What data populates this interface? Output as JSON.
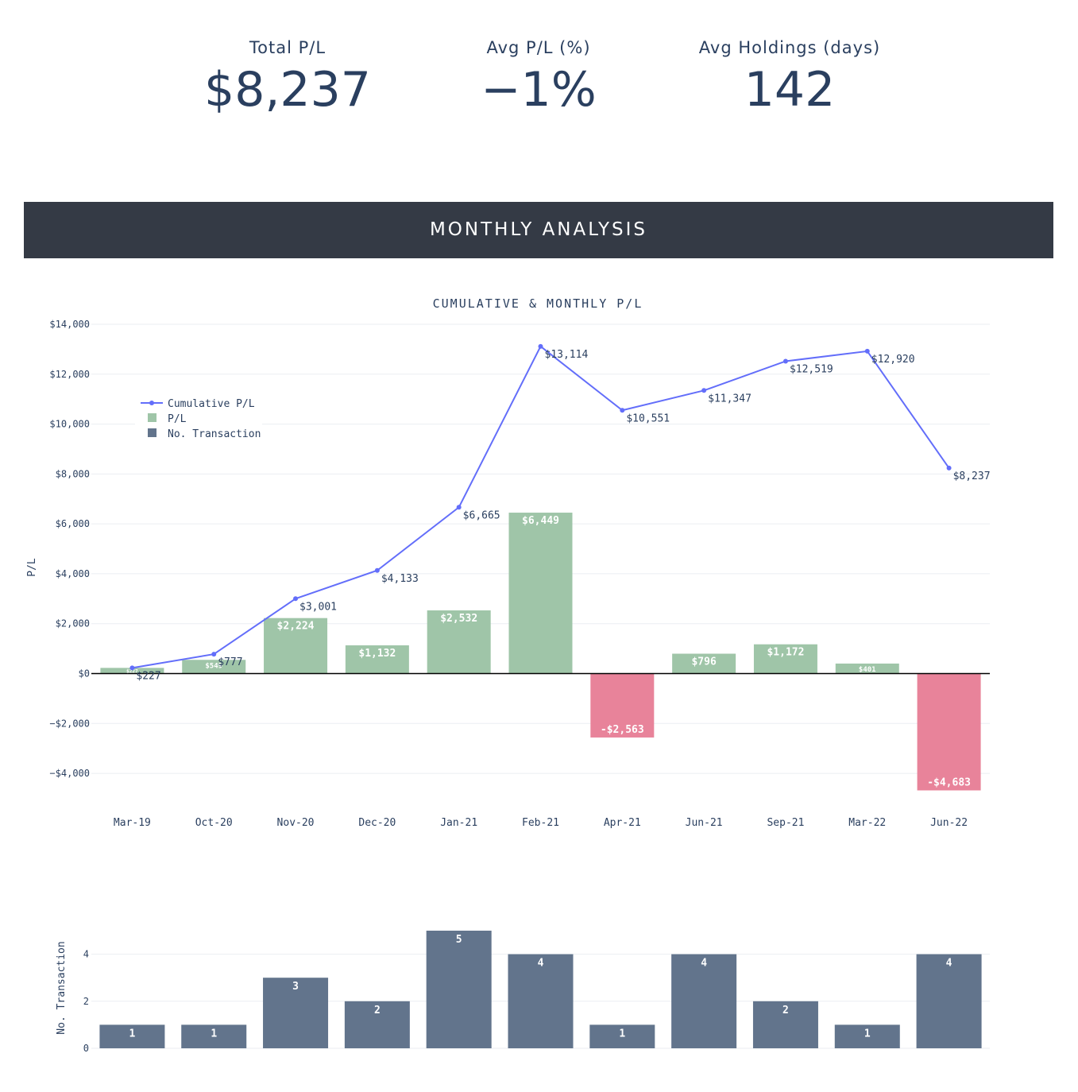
{
  "kpis": [
    {
      "label": "Total P/L",
      "value": "$8,237"
    },
    {
      "label": "Avg P/L (%)",
      "value": "−1%"
    },
    {
      "label": "Avg Holdings (days)",
      "value": "142"
    }
  ],
  "banner": {
    "title": "MONTHLY ANALYSIS"
  },
  "colors": {
    "positive_bar": "#9fc5a8",
    "negative_bar": "#e8839a",
    "line": "#636efa",
    "tx_bar": "#62748c",
    "banner_bg": "#343a45",
    "text": "#2a3f5f"
  },
  "chart_data": [
    {
      "type": "bar",
      "title": "CUMULATIVE & MONTHLY P/L",
      "ylabel": "P/L",
      "xlabel": "",
      "ylim": [
        -5300,
        14000
      ],
      "yticks": [
        -4000,
        -2000,
        0,
        2000,
        4000,
        6000,
        8000,
        10000,
        12000,
        14000
      ],
      "ytick_labels": [
        "−$4,000",
        "−$2,000",
        "$0",
        "$2,000",
        "$4,000",
        "$6,000",
        "$8,000",
        "$10,000",
        "$12,000",
        "$14,000"
      ],
      "categories": [
        "Mar-19",
        "Oct-20",
        "Nov-20",
        "Dec-20",
        "Jan-21",
        "Feb-21",
        "Apr-21",
        "Jun-21",
        "Sep-21",
        "Mar-22",
        "Jun-22"
      ],
      "legend": {
        "placement": "top-left",
        "items": [
          "Cumulative P/L",
          "P/L",
          "No. Transaction"
        ]
      },
      "series": [
        {
          "name": "P/L",
          "type": "bar",
          "values": [
            227,
            549,
            2224,
            1132,
            2532,
            6449,
            -2563,
            796,
            1172,
            401,
            -4683
          ],
          "labels": [
            "$227",
            "$549",
            "$2,224",
            "$1,132",
            "$2,532",
            "$6,449",
            "-$2,563",
            "$796",
            "$1,172",
            "$401",
            "-$4,683"
          ]
        },
        {
          "name": "Cumulative P/L",
          "type": "line",
          "values": [
            227,
            777,
            3001,
            4133,
            6665,
            13114,
            10551,
            11347,
            12519,
            12920,
            8237
          ],
          "labels": [
            "$227",
            "$777",
            "$3,001",
            "$4,133",
            "$6,665",
            "$13,114",
            "$10,551",
            "$11,347",
            "$12,519",
            "$12,920",
            "$8,237"
          ]
        }
      ],
      "grid": true
    },
    {
      "type": "bar",
      "ylabel": "No. Transaction",
      "ylim": [
        0,
        5
      ],
      "yticks": [
        0,
        2,
        4
      ],
      "categories": [
        "Mar-19",
        "Oct-20",
        "Nov-20",
        "Dec-20",
        "Jan-21",
        "Feb-21",
        "Apr-21",
        "Jun-21",
        "Sep-21",
        "Mar-22",
        "Jun-22"
      ],
      "series": [
        {
          "name": "No. Transaction",
          "values": [
            1,
            1,
            3,
            2,
            5,
            4,
            1,
            4,
            2,
            1,
            4
          ]
        }
      ],
      "grid": true
    }
  ]
}
